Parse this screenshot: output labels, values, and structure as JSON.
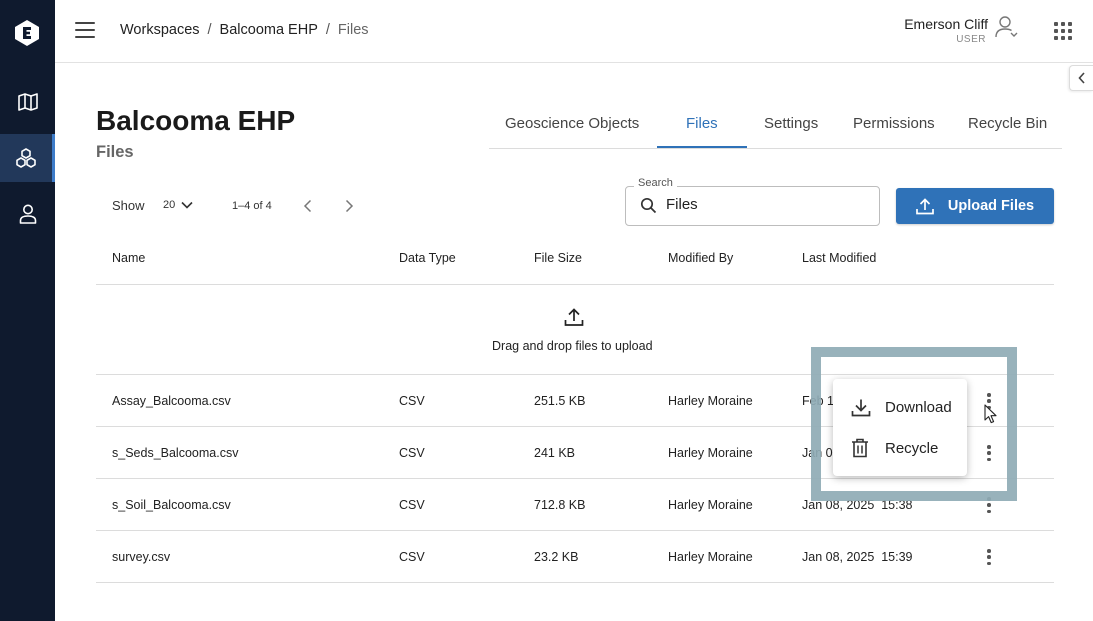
{
  "app": {
    "title": "Balcooma EHP",
    "colors": {
      "sidebar": "#0f1a2e",
      "accent": "#2f72b8",
      "highlight": "#8fabb5"
    }
  },
  "sidebar": {
    "logo_icon": "e-logo-icon",
    "items": [
      {
        "name": "map-icon",
        "active": false
      },
      {
        "name": "workspaces-icon",
        "active": true
      },
      {
        "name": "user-icon",
        "active": false
      }
    ]
  },
  "header": {
    "breadcrumb": [
      "Workspaces",
      "Balcooma EHP",
      "Files"
    ],
    "user": {
      "name": "Emerson Cliff",
      "role": "USER"
    }
  },
  "page": {
    "title": "Balcooma EHP",
    "subtitle": "Files"
  },
  "tabs": [
    {
      "label": "Geoscience Objects",
      "active": false
    },
    {
      "label": "Files",
      "active": true
    },
    {
      "label": "Settings",
      "active": false
    },
    {
      "label": "Permissions",
      "active": false
    },
    {
      "label": "Recycle Bin",
      "active": false
    }
  ],
  "toolbar": {
    "show_label": "Show",
    "page_size": "20",
    "range": "1–4 of 4",
    "search_legend": "Search",
    "search_value": "Files",
    "upload_label": "Upload Files"
  },
  "table": {
    "columns": [
      "Name",
      "Data Type",
      "File Size",
      "Modified By",
      "Last Modified"
    ],
    "drop_text": "Drag and drop files to upload",
    "rows": [
      {
        "name": "Assay_Balcooma.csv",
        "type": "CSV",
        "size": "251.5 KB",
        "modified_by": "Harley Moraine",
        "last_modified": "Feb 18"
      },
      {
        "name": "s_Seds_Balcooma.csv",
        "type": "CSV",
        "size": "241 KB",
        "modified_by": "Harley Moraine",
        "last_modified": "Jan 0"
      },
      {
        "name": "s_Soil_Balcooma.csv",
        "type": "CSV",
        "size": "712.8 KB",
        "modified_by": "Harley Moraine",
        "last_modified": "Jan 08, 2025  15:38"
      },
      {
        "name": "survey.csv",
        "type": "CSV",
        "size": "23.2 KB",
        "modified_by": "Harley Moraine",
        "last_modified": "Jan 08, 2025  15:39"
      }
    ]
  },
  "context_menu": {
    "items": [
      {
        "label": "Download",
        "icon": "download-icon"
      },
      {
        "label": "Recycle",
        "icon": "trash-icon"
      }
    ]
  }
}
